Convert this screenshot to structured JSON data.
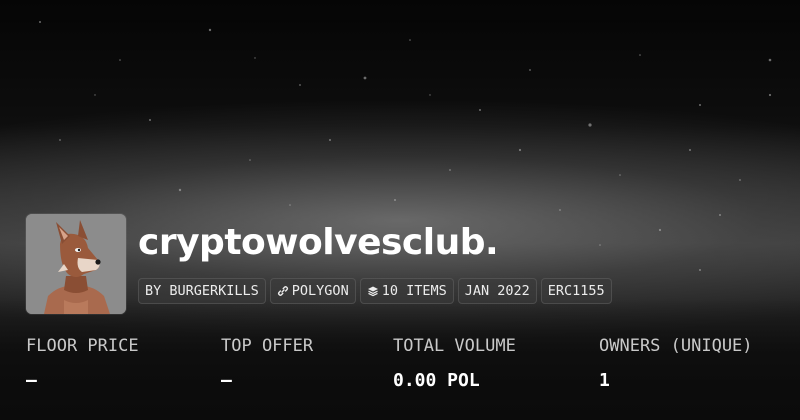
{
  "collection": {
    "name": "cryptowolvesclub.",
    "avatar_alt": "wolf avatar"
  },
  "chips": {
    "creator": "BY BURGERKILLS",
    "chain_icon": "link-icon",
    "chain": "POLYGON",
    "items_icon": "layers-icon",
    "items": "10 ITEMS",
    "date": "JAN 2022",
    "standard": "ERC1155"
  },
  "stats": {
    "floor_label": "FLOOR PRICE",
    "floor_value": "—",
    "offer_label": "TOP OFFER",
    "offer_value": "—",
    "volume_label": "TOTAL VOLUME",
    "volume_value": "0.00 POL",
    "owners_label": "OWNERS (UNIQUE)",
    "owners_value": "1"
  }
}
